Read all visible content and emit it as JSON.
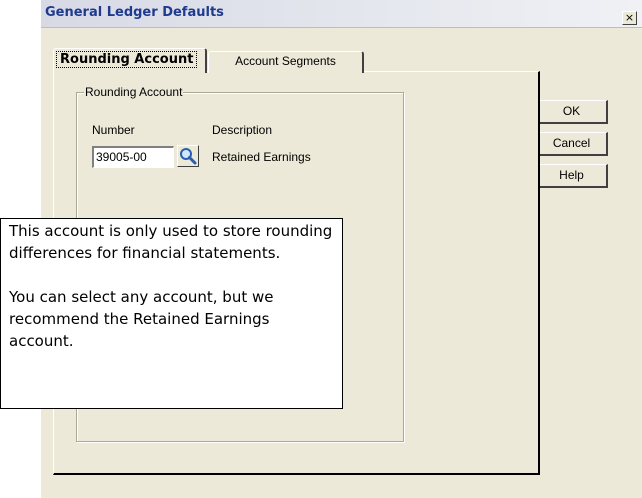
{
  "window": {
    "title": "General Ledger Defaults",
    "close_glyph": "×"
  },
  "tabs": [
    {
      "label": "Rounding Account",
      "active": true
    },
    {
      "label": "Account Segments",
      "active": false
    }
  ],
  "group": {
    "legend": "Rounding Account",
    "number_label": "Number",
    "description_label": "Description",
    "number_value": "39005-00",
    "description_value": "Retained Earnings",
    "lookup_icon": "magnifier-icon"
  },
  "buttons": {
    "ok": "OK",
    "cancel": "Cancel",
    "help": "Help"
  },
  "callout": {
    "paragraph1": "This account is only used to store rounding differences for financial statements.",
    "paragraph2": "You can select any account, but we recommend the Retained Earnings account."
  }
}
